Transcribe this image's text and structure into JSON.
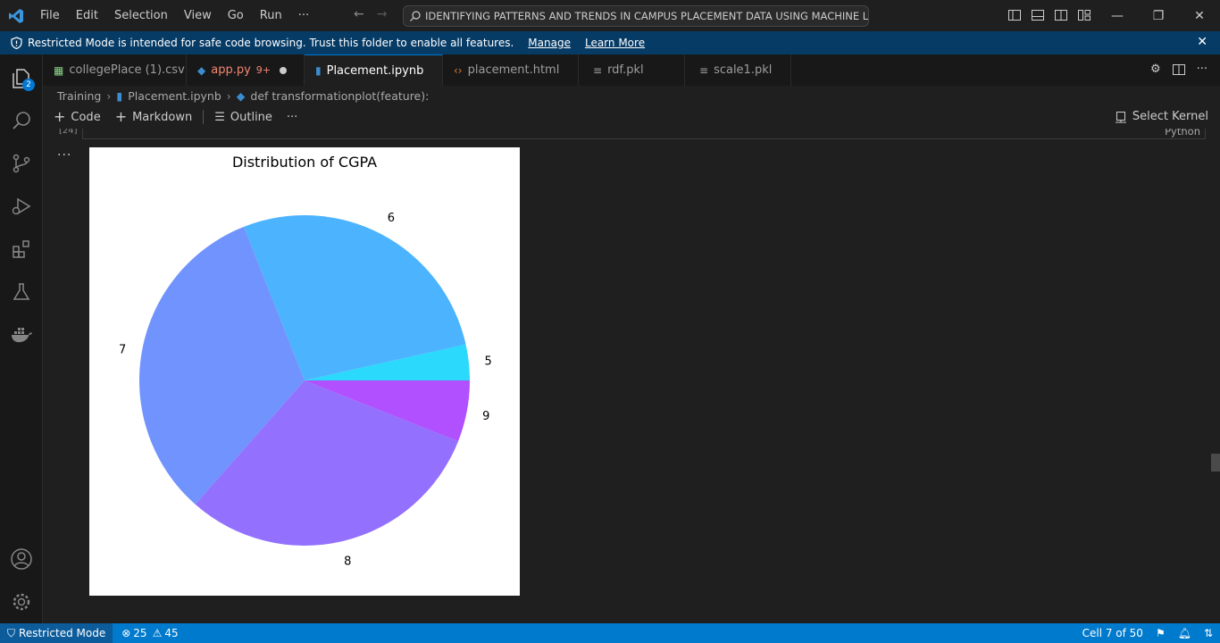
{
  "menu": [
    "File",
    "Edit",
    "Selection",
    "View",
    "Go",
    "Run",
    "···"
  ],
  "command_center": "IDENTIFYING PATTERNS AND TRENDS IN CAMPUS PLACEMENT DATA USING MACHINE LEAR...",
  "banner": {
    "message": "Restricted Mode is intended for safe code browsing. Trust this folder to enable all features.",
    "manage": "Manage",
    "learn_more": "Learn More"
  },
  "activity": {
    "explorer_badge": "2"
  },
  "tabs": [
    {
      "label": "collegePlace (1).csv",
      "icon": "csv-file-icon"
    },
    {
      "label": "app.py",
      "problems": "9+",
      "icon": "python-file-icon"
    },
    {
      "label": "Placement.ipynb",
      "icon": "notebook-file-icon"
    },
    {
      "label": "placement.html",
      "icon": "html-file-icon"
    },
    {
      "label": "rdf.pkl",
      "icon": "file-lines-icon"
    },
    {
      "label": "scale1.pkl",
      "icon": "file-lines-icon"
    }
  ],
  "breadcrumb": [
    "Training",
    "Placement.ipynb",
    "def transformationplot(feature):"
  ],
  "toolbar": {
    "code": "Code",
    "markdown": "Markdown",
    "outline": "Outline",
    "more": "···",
    "kernel": "Select Kernel"
  },
  "cell": {
    "exec_count": "[24]",
    "language": "Python",
    "output_more": "···"
  },
  "chart_data": {
    "type": "pie",
    "title": "Distribution of CGPA",
    "labels": [
      "5",
      "6",
      "7",
      "8",
      "9"
    ],
    "values": [
      3.5,
      27.5,
      32.5,
      30.5,
      6.0
    ],
    "colors": [
      "#2ad9fb",
      "#4cb3fe",
      "#7093fd",
      "#9370fe",
      "#b050fe"
    ],
    "start_angle_deg": 0,
    "direction": "counterclockwise"
  },
  "status": {
    "restricted": "Restricted Mode",
    "errors": "25",
    "warnings": "45",
    "cell": "Cell 7 of 50"
  }
}
